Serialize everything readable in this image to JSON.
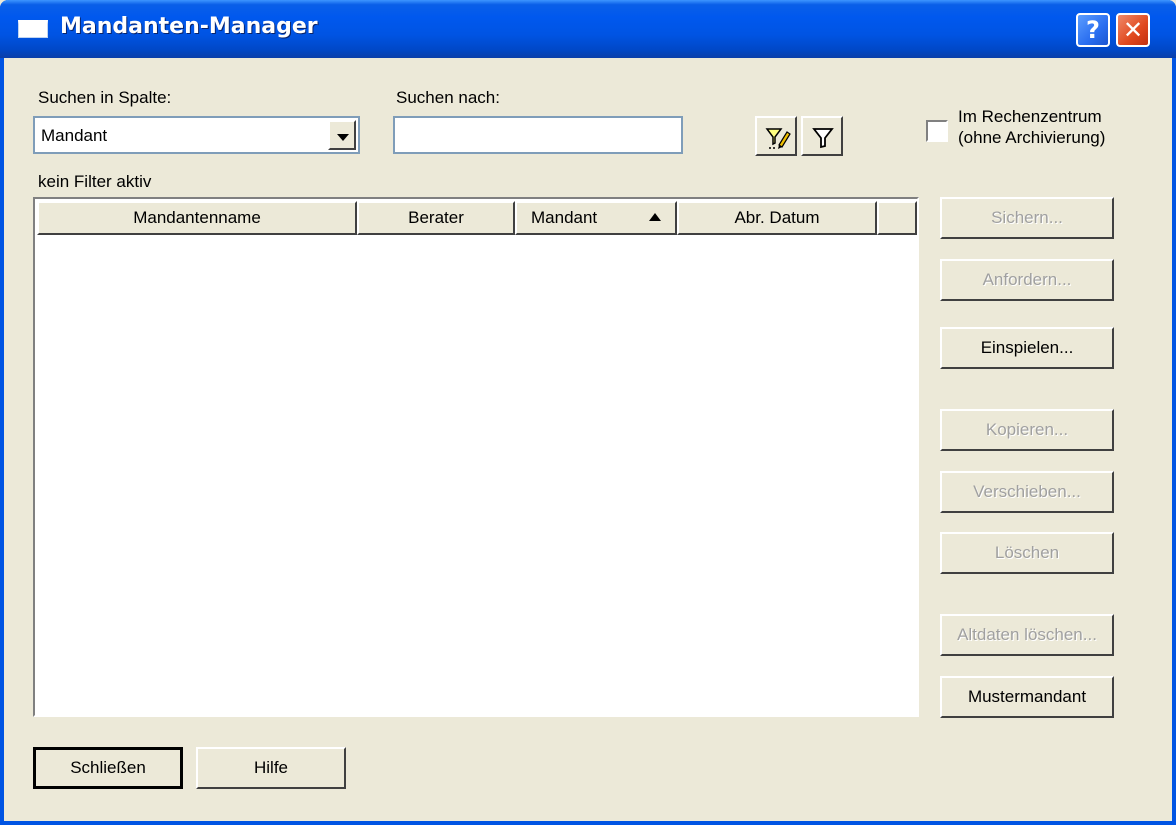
{
  "window": {
    "title": "Mandanten-Manager",
    "help_label": "?",
    "close_label": "✕"
  },
  "search": {
    "column_label": "Suchen in Spalte:",
    "column_value": "Mandant",
    "term_label": "Suchen nach:",
    "term_value": "",
    "filter_status": "kein Filter aktiv"
  },
  "rechenzentrum": {
    "line1": "Im Rechenzentrum",
    "line2": "(ohne Archivierung)",
    "checked": false
  },
  "table": {
    "columns": [
      "Mandantenname",
      "Berater",
      "Mandant",
      "Abr. Datum"
    ],
    "sort_column": "Mandant",
    "sort_direction": "ascending",
    "rows": []
  },
  "actions": [
    {
      "label": "Sichern...",
      "enabled": false
    },
    {
      "label": "Anfordern...",
      "enabled": false
    },
    {
      "label": "Einspielen...",
      "enabled": true
    },
    {
      "label": "Kopieren...",
      "enabled": false
    },
    {
      "label": "Verschieben...",
      "enabled": false
    },
    {
      "label": "Löschen",
      "enabled": false
    },
    {
      "label": "Altdaten löschen...",
      "enabled": false
    },
    {
      "label": "Mustermandant",
      "enabled": true
    }
  ],
  "footer": {
    "close_label": "Schließen",
    "help_label": "Hilfe"
  },
  "icons": [
    "filter-edit-icon",
    "filter-icon",
    "sort-ascending-icon",
    "chevron-down-icon"
  ]
}
